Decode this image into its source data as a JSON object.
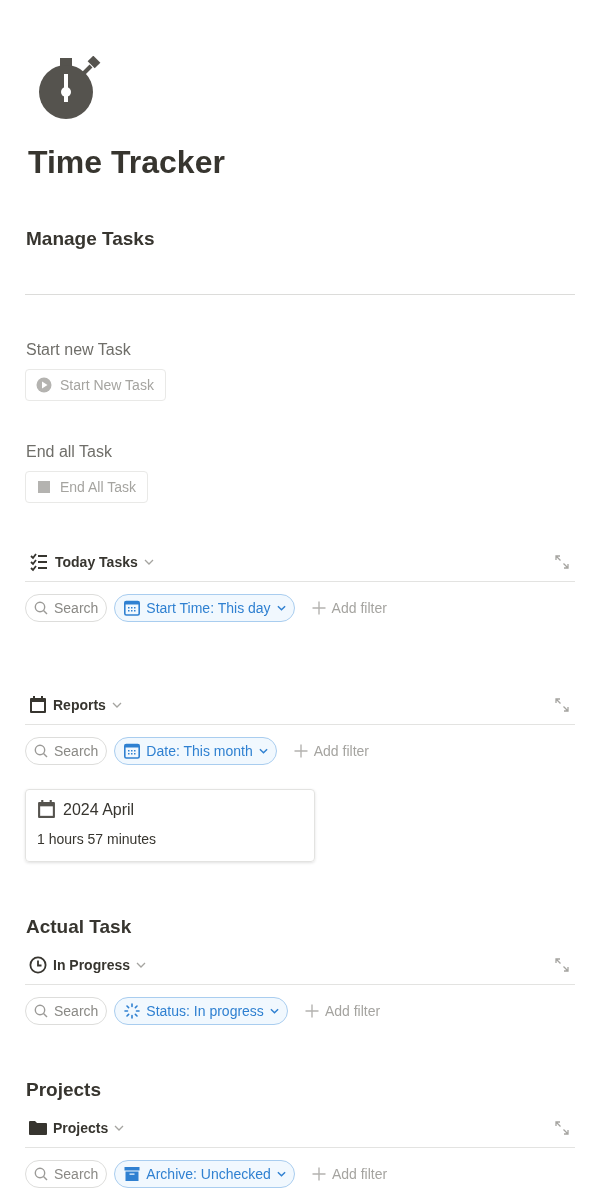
{
  "page": {
    "title": "Time Tracker"
  },
  "blocks": [
    {
      "kind": "heading",
      "text": "Manage Tasks"
    },
    {
      "kind": "divider"
    },
    {
      "kind": "button",
      "label": "Start new Task",
      "button": "Start New Task"
    },
    {
      "kind": "button",
      "label": "End all Task",
      "button": "End All Task"
    },
    {
      "kind": "database",
      "view": "Today Tasks",
      "search": "Search",
      "filter": "Start Time: This day",
      "add_filter": "Add filter"
    },
    {
      "kind": "database",
      "view": "Reports",
      "search": "Search",
      "filter": "Date: This month",
      "add_filter": "Add filter",
      "cards": [
        {
          "title": "2024 April",
          "value": "1 hours 57 minutes"
        }
      ]
    },
    {
      "kind": "heading",
      "text": "Actual Task"
    },
    {
      "kind": "database",
      "view": "In Progress",
      "search": "Search",
      "filter": "Status: In progress",
      "add_filter": "Add filter"
    },
    {
      "kind": "heading",
      "text": "Projects"
    },
    {
      "kind": "database",
      "view": "Projects",
      "search": "Search",
      "filter": "Archive: Unchecked",
      "add_filter": "Add filter"
    }
  ]
}
